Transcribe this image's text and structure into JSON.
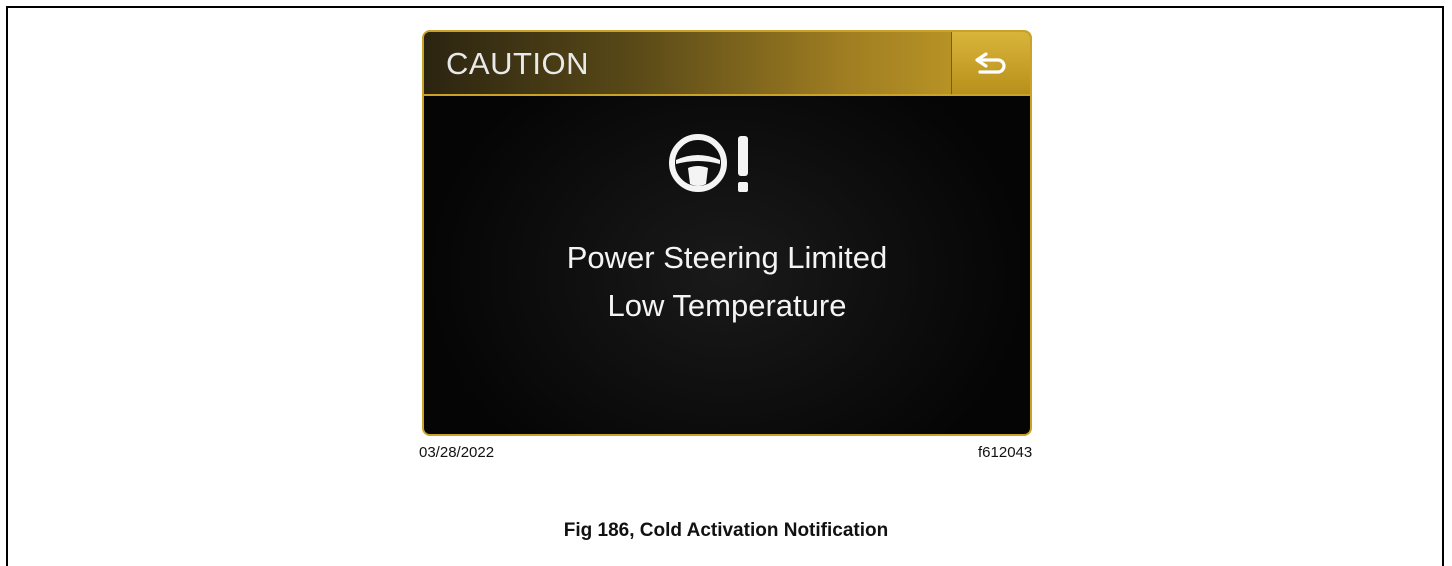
{
  "screen": {
    "header_title": "CAUTION",
    "icons": [
      "steering-wheel-warning-icon",
      "back-arrow-icon"
    ],
    "message_line1": "Power Steering Limited",
    "message_line2": "Low Temperature"
  },
  "figure": {
    "date": "03/28/2022",
    "code": "f612043",
    "caption": "Fig 186, Cold Activation Notification"
  },
  "colors": {
    "accent_gold": "#c9a227",
    "screen_bg": "#050505",
    "text": "#f4f4f4"
  }
}
